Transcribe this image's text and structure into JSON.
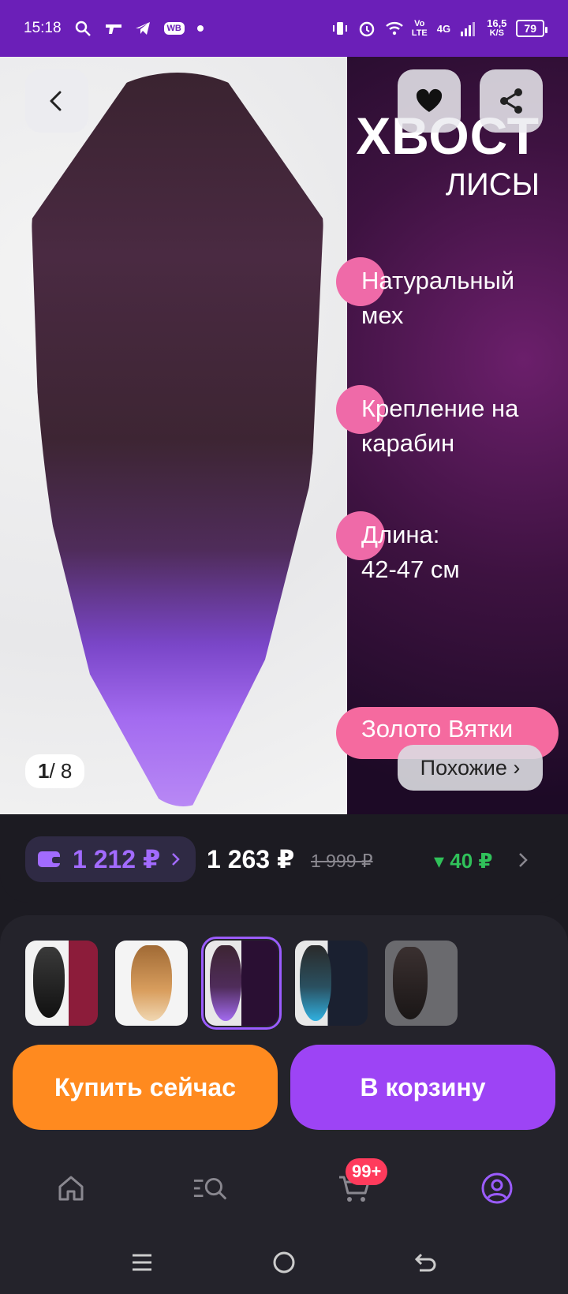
{
  "status_bar": {
    "time": "15:18",
    "wb_badge": "WB",
    "net_type_top": "Vo",
    "net_type_bottom": "LTE",
    "signal_label": "4G",
    "speed_top": "16,5",
    "speed_bottom": "K/S",
    "battery": "79"
  },
  "hero": {
    "title": "ХВОСТ",
    "subtitle": "ЛИСЫ",
    "features": [
      {
        "line1": "Натуральный",
        "line2": "мех"
      },
      {
        "line1": "Крепление на",
        "line2": "карабин"
      },
      {
        "line1": "Длина:",
        "line2": "42-47 см"
      }
    ],
    "brand": "Золото Вятки",
    "page_current": "1",
    "page_total": "/ 8",
    "similar_label": "Похожие ›"
  },
  "price": {
    "wallet_price": "1 212 ₽",
    "current_price": "1 263 ₽",
    "old_price": "1 999 ₽",
    "price_drop": "▾ 40 ₽"
  },
  "actions": {
    "buy_now": "Купить сейчас",
    "add_to_cart": "В корзину"
  },
  "nav": {
    "cart_badge": "99+"
  },
  "colors": {
    "status_bar": "#6b1fb8",
    "accent_purple": "#9d44f5",
    "buy_orange": "#ff8a1f",
    "price_green": "#30c15a",
    "wallet_purple": "#a26bff"
  }
}
